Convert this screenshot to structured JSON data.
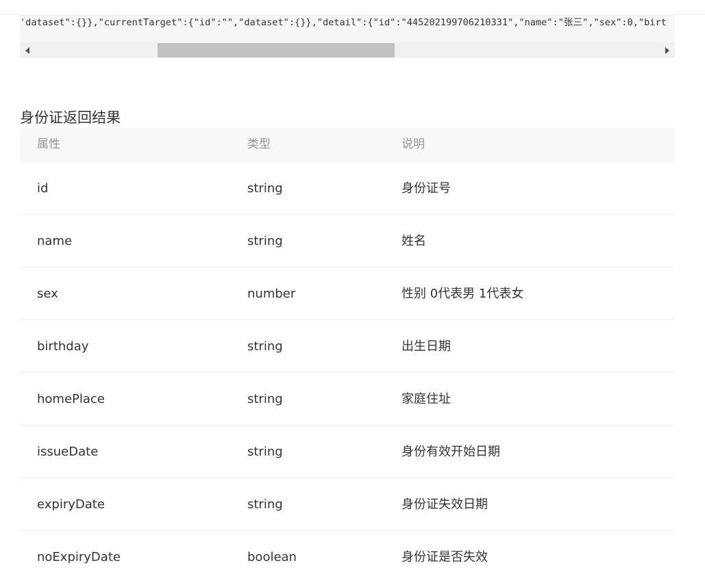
{
  "code_block": {
    "line": "'dataset\":{}},\"currentTarget\":{\"id\":\"\",\"dataset\":{}},\"detail\":{\"id\":\"445202199706210331\",\"name\":\"张三\",\"sex\":0,\"birt"
  },
  "section": {
    "title": "身份证返回结果"
  },
  "table": {
    "headers": [
      "属性",
      "类型",
      "说明"
    ],
    "rows": [
      {
        "prop": "id",
        "type": "string",
        "desc": "身份证号"
      },
      {
        "prop": "name",
        "type": "string",
        "desc": "姓名"
      },
      {
        "prop": "sex",
        "type": "number",
        "desc": "性别 0代表男 1代表女"
      },
      {
        "prop": "birthday",
        "type": "string",
        "desc": "出生日期"
      },
      {
        "prop": "homePlace",
        "type": "string",
        "desc": "家庭住址"
      },
      {
        "prop": "issueDate",
        "type": "string",
        "desc": "身份有效开始日期"
      },
      {
        "prop": "expiryDate",
        "type": "string",
        "desc": "身份证失效日期"
      },
      {
        "prop": "noExpiryDate",
        "type": "boolean",
        "desc": "身份证是否失效"
      }
    ]
  },
  "colors": {
    "header_bg": "#f8f8f9",
    "header_text": "#909399",
    "row_border": "#ebeef5",
    "code_bg": "#f6f6f6",
    "scroll_thumb": "#c1c1c1"
  }
}
